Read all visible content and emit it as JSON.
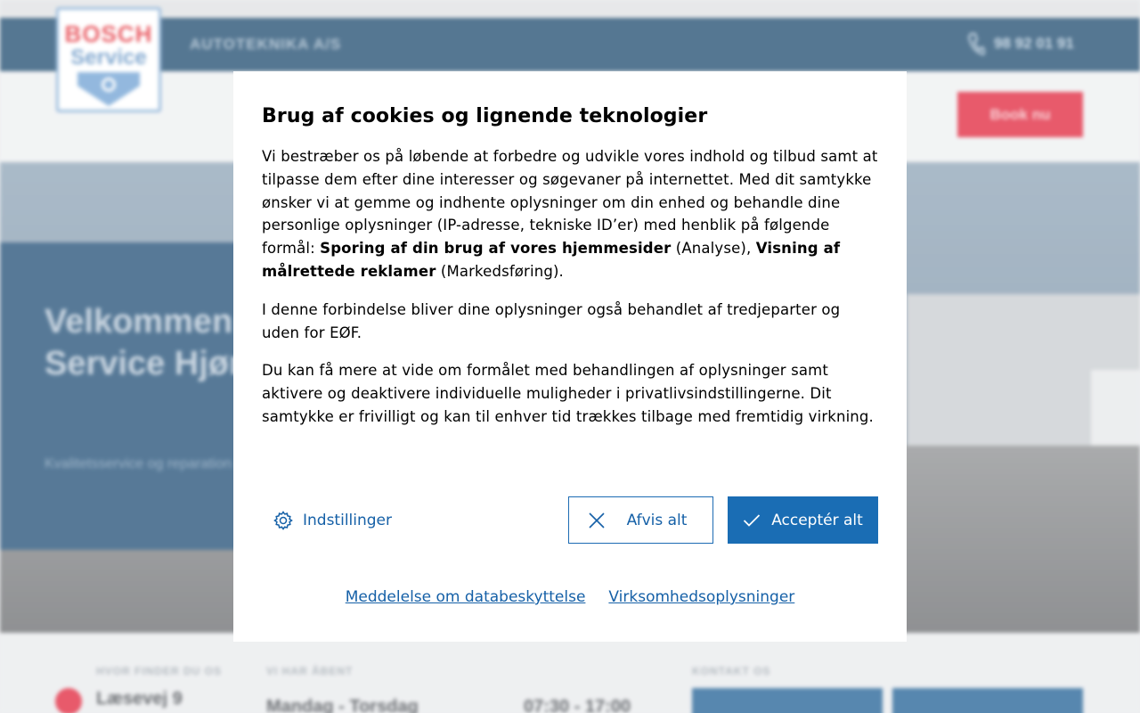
{
  "background": {
    "company_name": "AUTOTEKNIKA A/S",
    "phone": "98 92 01 91",
    "logo": {
      "line1": "BOSCH",
      "line2": "Service"
    },
    "book_button": "Book nu",
    "hero_title": "Velkommen til AUTOTEKNIKA Service Hjørring",
    "hero_subtitle": "Kvalitetsservice og reparation af alle bilmærker",
    "footer": {
      "find_label": "HVOR FINDER DU OS",
      "address": "Læsevej 9",
      "open_label": "VI HAR ÅBENT",
      "day": "Mandag - Torsdag",
      "time": "07:30 - 17:00",
      "contact_label": "KONTAKT OS"
    }
  },
  "cookie_dialog": {
    "title": "Brug af cookies og lignende teknologier",
    "p1_part1": "Vi bestræber os på løbende at forbedre og udvikle vores indhold og tilbud samt at tilpasse dem efter dine interesser og søgevaner på internettet. Med dit samtykke ønsker vi at gemme og indhente oplysninger om din enhed og behandle dine personlige oplysninger (IP-adresse, tekniske ID’er) med henblik på følgende formål: ",
    "p1_bold1": "Sporing af din brug af vores hjemmesider",
    "p1_part2": " (Analyse), ",
    "p1_bold2": "Visning af målrettede reklamer",
    "p1_part3": " (Markedsføring).",
    "p2": "I denne forbindelse bliver dine oplysninger også behandlet af tredjeparter og uden for EØF.",
    "p3": "Du kan få mere at vide om formålet med behandlingen af oplysninger samt aktivere og deaktivere individuelle muligheder i privatlivsindstillingerne. Dit samtykke er frivilligt og kan til enhver tid trækkes tilbage med fremtidig virkning.",
    "settings_label": "Indstillinger",
    "reject_label": "Afvis alt",
    "accept_label": "Acceptér alt",
    "link_privacy": "Meddelelse om databeskyttelse",
    "link_company": "Virksomhedsoplysninger"
  },
  "colors": {
    "brand_blue": "#1a6db4",
    "nav_blue": "#1d4a6e",
    "book_red": "#e0233a"
  }
}
